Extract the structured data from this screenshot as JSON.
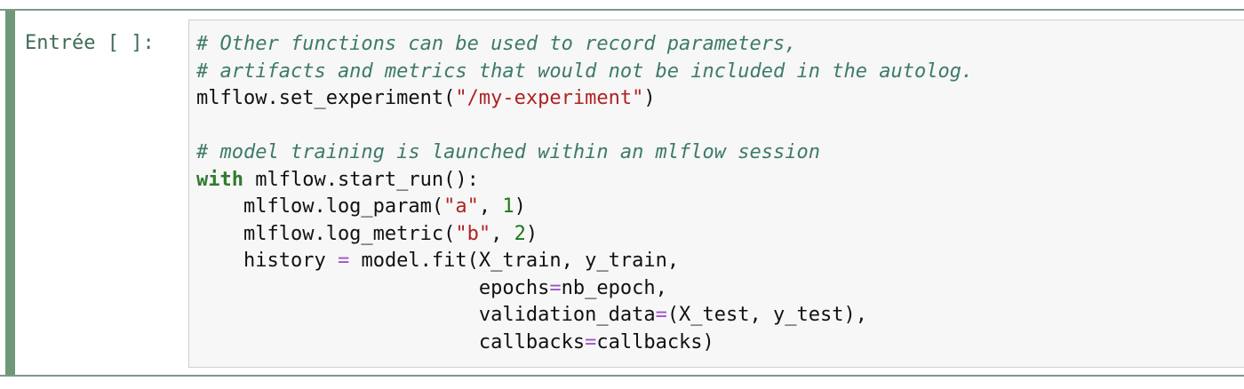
{
  "cell": {
    "prompt": "Entrée [ ]:",
    "code_lines": [
      [
        {
          "t": "# Other functions can be used to record parameters,",
          "c": "cm"
        }
      ],
      [
        {
          "t": "# artifacts and metrics that would not be included in the autolog.",
          "c": "cm"
        }
      ],
      [
        {
          "t": "mlflow.set_experiment(",
          "c": ""
        },
        {
          "t": "\"/my-experiment\"",
          "c": "st"
        },
        {
          "t": ")",
          "c": ""
        }
      ],
      [],
      [
        {
          "t": "# model training is launched within an mlflow session",
          "c": "cm"
        }
      ],
      [
        {
          "t": "with",
          "c": "kw"
        },
        {
          "t": " mlflow.start_run():",
          "c": ""
        }
      ],
      [
        {
          "t": "    mlflow.log_param(",
          "c": ""
        },
        {
          "t": "\"a\"",
          "c": "st"
        },
        {
          "t": ", ",
          "c": ""
        },
        {
          "t": "1",
          "c": "nm"
        },
        {
          "t": ")",
          "c": ""
        }
      ],
      [
        {
          "t": "    mlflow.log_metric(",
          "c": ""
        },
        {
          "t": "\"b\"",
          "c": "st"
        },
        {
          "t": ", ",
          "c": ""
        },
        {
          "t": "2",
          "c": "nm"
        },
        {
          "t": ")",
          "c": ""
        }
      ],
      [
        {
          "t": "    history ",
          "c": ""
        },
        {
          "t": "=",
          "c": "op"
        },
        {
          "t": " model.fit(X_train, y_train,",
          "c": ""
        }
      ],
      [
        {
          "t": "                        epochs",
          "c": ""
        },
        {
          "t": "=",
          "c": "op"
        },
        {
          "t": "nb_epoch,",
          "c": ""
        }
      ],
      [
        {
          "t": "                        validation_data",
          "c": ""
        },
        {
          "t": "=",
          "c": "op"
        },
        {
          "t": "(X_test, y_test),",
          "c": ""
        }
      ],
      [
        {
          "t": "                        callbacks",
          "c": ""
        },
        {
          "t": "=",
          "c": "op"
        },
        {
          "t": "callbacks)",
          "c": ""
        }
      ]
    ]
  },
  "colors": {
    "selected_cell_accent": "#6f9878",
    "comment": "#3d7a6a",
    "keyword": "#2f7a2f",
    "string": "#b02222",
    "number": "#1a7a1a",
    "operator": "#9c55c5"
  }
}
